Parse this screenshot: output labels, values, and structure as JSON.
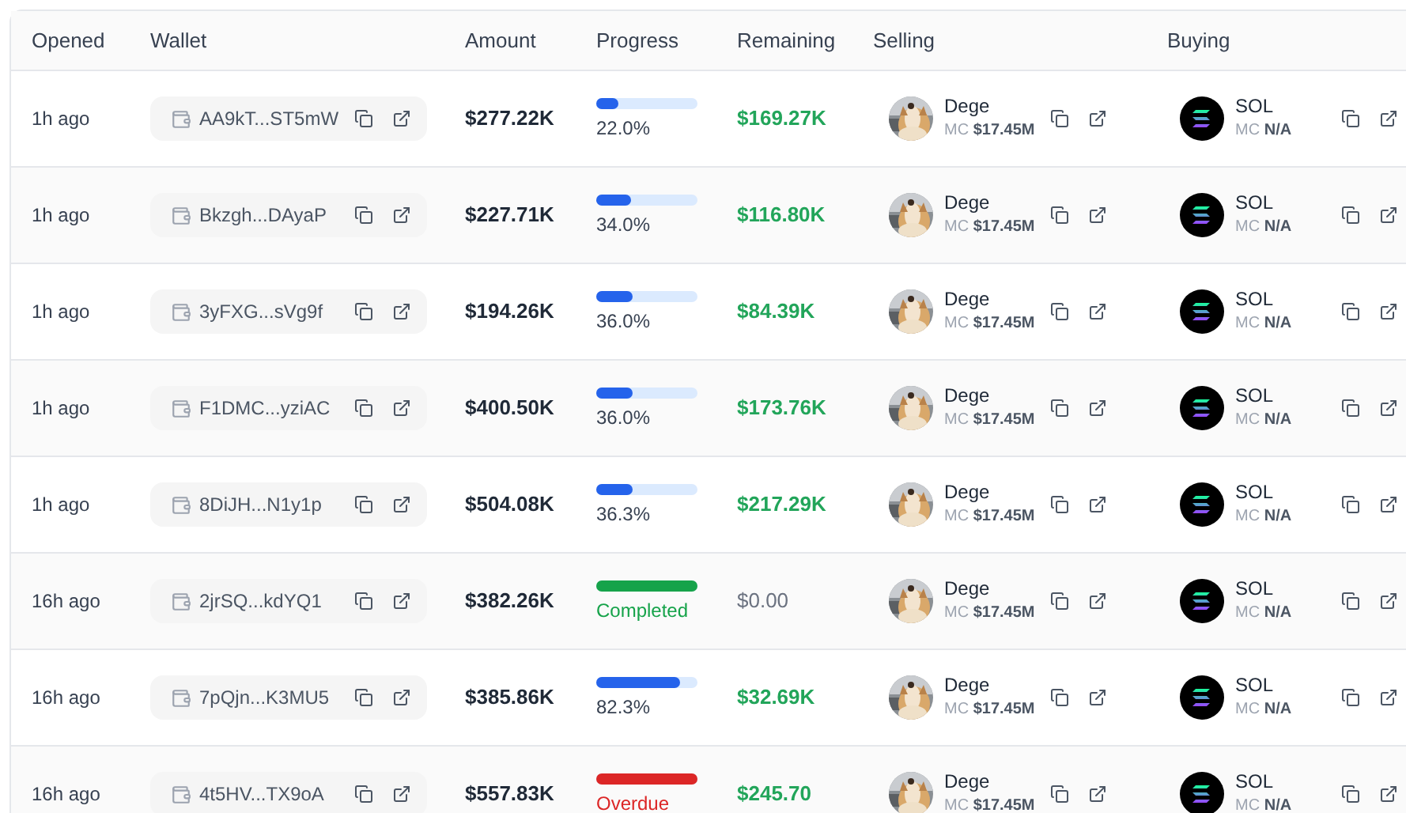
{
  "columns": [
    "Opened",
    "Wallet",
    "Amount",
    "Progress",
    "Remaining",
    "Selling",
    "Buying"
  ],
  "rows": [
    {
      "opened": "1h ago",
      "wallet": "AA9kT...ST5mW",
      "amount": "$277.22K",
      "progress": {
        "kind": "active",
        "level": 0.22,
        "label": "22.0%"
      },
      "remaining": {
        "text": "$169.27K",
        "settled": false
      },
      "selling": {
        "symbol": "Dege",
        "mc_label": "MC",
        "mc": "$17.45M"
      },
      "buying": {
        "symbol": "SOL",
        "mc_label": "MC",
        "mc": "N/A"
      }
    },
    {
      "opened": "1h ago",
      "wallet": "Bkzgh...DAyaP",
      "amount": "$227.71K",
      "progress": {
        "kind": "active",
        "level": 0.34,
        "label": "34.0%"
      },
      "remaining": {
        "text": "$116.80K",
        "settled": false
      },
      "selling": {
        "symbol": "Dege",
        "mc_label": "MC",
        "mc": "$17.45M"
      },
      "buying": {
        "symbol": "SOL",
        "mc_label": "MC",
        "mc": "N/A"
      }
    },
    {
      "opened": "1h ago",
      "wallet": "3yFXG...sVg9f",
      "amount": "$194.26K",
      "progress": {
        "kind": "active",
        "level": 0.36,
        "label": "36.0%"
      },
      "remaining": {
        "text": "$84.39K",
        "settled": false
      },
      "selling": {
        "symbol": "Dege",
        "mc_label": "MC",
        "mc": "$17.45M"
      },
      "buying": {
        "symbol": "SOL",
        "mc_label": "MC",
        "mc": "N/A"
      }
    },
    {
      "opened": "1h ago",
      "wallet": "F1DMC...yziAC",
      "amount": "$400.50K",
      "progress": {
        "kind": "active",
        "level": 0.36,
        "label": "36.0%"
      },
      "remaining": {
        "text": "$173.76K",
        "settled": false
      },
      "selling": {
        "symbol": "Dege",
        "mc_label": "MC",
        "mc": "$17.45M"
      },
      "buying": {
        "symbol": "SOL",
        "mc_label": "MC",
        "mc": "N/A"
      }
    },
    {
      "opened": "1h ago",
      "wallet": "8DiJH...N1y1p",
      "amount": "$504.08K",
      "progress": {
        "kind": "active",
        "level": 0.363,
        "label": "36.3%"
      },
      "remaining": {
        "text": "$217.29K",
        "settled": false
      },
      "selling": {
        "symbol": "Dege",
        "mc_label": "MC",
        "mc": "$17.45M"
      },
      "buying": {
        "symbol": "SOL",
        "mc_label": "MC",
        "mc": "N/A"
      }
    },
    {
      "opened": "16h ago",
      "wallet": "2jrSQ...kdYQ1",
      "amount": "$382.26K",
      "progress": {
        "kind": "completed",
        "level": 1,
        "label": "Completed"
      },
      "remaining": {
        "text": "$0.00",
        "settled": true
      },
      "selling": {
        "symbol": "Dege",
        "mc_label": "MC",
        "mc": "$17.45M"
      },
      "buying": {
        "symbol": "SOL",
        "mc_label": "MC",
        "mc": "N/A"
      }
    },
    {
      "opened": "16h ago",
      "wallet": "7pQjn...K3MU5",
      "amount": "$385.86K",
      "progress": {
        "kind": "active",
        "level": 0.823,
        "label": "82.3%"
      },
      "remaining": {
        "text": "$32.69K",
        "settled": false
      },
      "selling": {
        "symbol": "Dege",
        "mc_label": "MC",
        "mc": "$17.45M"
      },
      "buying": {
        "symbol": "SOL",
        "mc_label": "MC",
        "mc": "N/A"
      }
    },
    {
      "opened": "16h ago",
      "wallet": "4t5HV...TX9oA",
      "amount": "$557.83K",
      "progress": {
        "kind": "overdue",
        "level": 1,
        "label": "Overdue"
      },
      "remaining": {
        "text": "$245.70",
        "settled": false
      },
      "selling": {
        "symbol": "Dege",
        "mc_label": "MC",
        "mc": "$17.45M"
      },
      "buying": {
        "symbol": "SOL",
        "mc_label": "MC",
        "mc": "N/A"
      }
    }
  ]
}
